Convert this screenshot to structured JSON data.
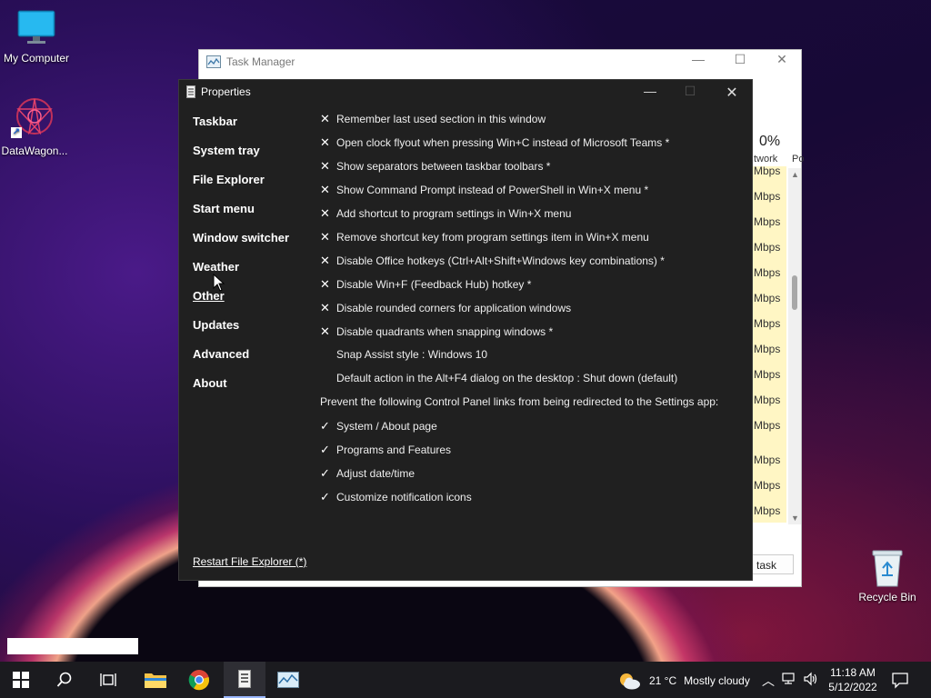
{
  "desktop": {
    "icons": [
      {
        "label": "My Computer",
        "icon": "monitor-icon"
      },
      {
        "label": "DataWagon...",
        "icon": "datawagon-icon"
      },
      {
        "label": "Recycle Bin",
        "icon": "recycle-bin-icon"
      }
    ]
  },
  "task_manager": {
    "title": "Task Manager",
    "network_pct": "0%",
    "network_label": "twork",
    "power_label": "Po",
    "cells": [
      "Mbps",
      "Mbps",
      "Mbps",
      "Mbps",
      "Mbps",
      "Mbps",
      "Mbps",
      "Mbps",
      "Mbps",
      "Mbps",
      "Mbps",
      "Mbps",
      "Mbps",
      "Mbps"
    ],
    "end_task_label": "task"
  },
  "properties": {
    "title": "Properties",
    "nav": [
      {
        "label": "Taskbar",
        "active": false
      },
      {
        "label": "System tray",
        "active": false
      },
      {
        "label": "File Explorer",
        "active": false
      },
      {
        "label": "Start menu",
        "active": false
      },
      {
        "label": "Window switcher",
        "active": false
      },
      {
        "label": "Weather",
        "active": false
      },
      {
        "label": "Other",
        "active": true
      },
      {
        "label": "Updates",
        "active": false
      },
      {
        "label": "Advanced",
        "active": false
      },
      {
        "label": "About",
        "active": false
      }
    ],
    "options": [
      {
        "mark": "✕",
        "text": "Remember last used section in this window"
      },
      {
        "mark": "✕",
        "text": "Open clock flyout when pressing Win+C instead of Microsoft Teams *"
      },
      {
        "mark": "✕",
        "text": "Show separators between taskbar toolbars *"
      },
      {
        "mark": "✕",
        "text": "Show Command Prompt instead of PowerShell in Win+X menu *"
      },
      {
        "mark": "✕",
        "text": "Add shortcut to program settings in Win+X menu"
      },
      {
        "mark": "✕",
        "text": "Remove shortcut key from program settings item in Win+X menu"
      },
      {
        "mark": "✕",
        "text": "Disable Office hotkeys (Ctrl+Alt+Shift+Windows key combinations) *"
      },
      {
        "mark": "✕",
        "text": "Disable Win+F (Feedback Hub) hotkey *"
      },
      {
        "mark": "✕",
        "text": "Disable rounded corners for application windows"
      },
      {
        "mark": "✕",
        "text": "Disable quadrants when snapping windows *"
      },
      {
        "mark": "",
        "text": "Snap Assist style : Windows 10"
      },
      {
        "mark": "",
        "text": "Default action in the Alt+F4 dialog on the desktop : Shut down (default)"
      },
      {
        "mark": null,
        "text": "Prevent the following Control Panel links from being redirected to the Settings app:"
      },
      {
        "mark": "✓",
        "text": "System / About page"
      },
      {
        "mark": "✓",
        "text": "Programs and Features"
      },
      {
        "mark": "✓",
        "text": "Adjust date/time"
      },
      {
        "mark": "✓",
        "text": "Customize notification icons"
      }
    ],
    "restart_link": "Restart File Explorer (*)"
  },
  "taskbar": {
    "weather_temp": "21 °C",
    "weather_text": "Mostly cloudy",
    "time": "11:18 AM",
    "date": "5/12/2022"
  }
}
